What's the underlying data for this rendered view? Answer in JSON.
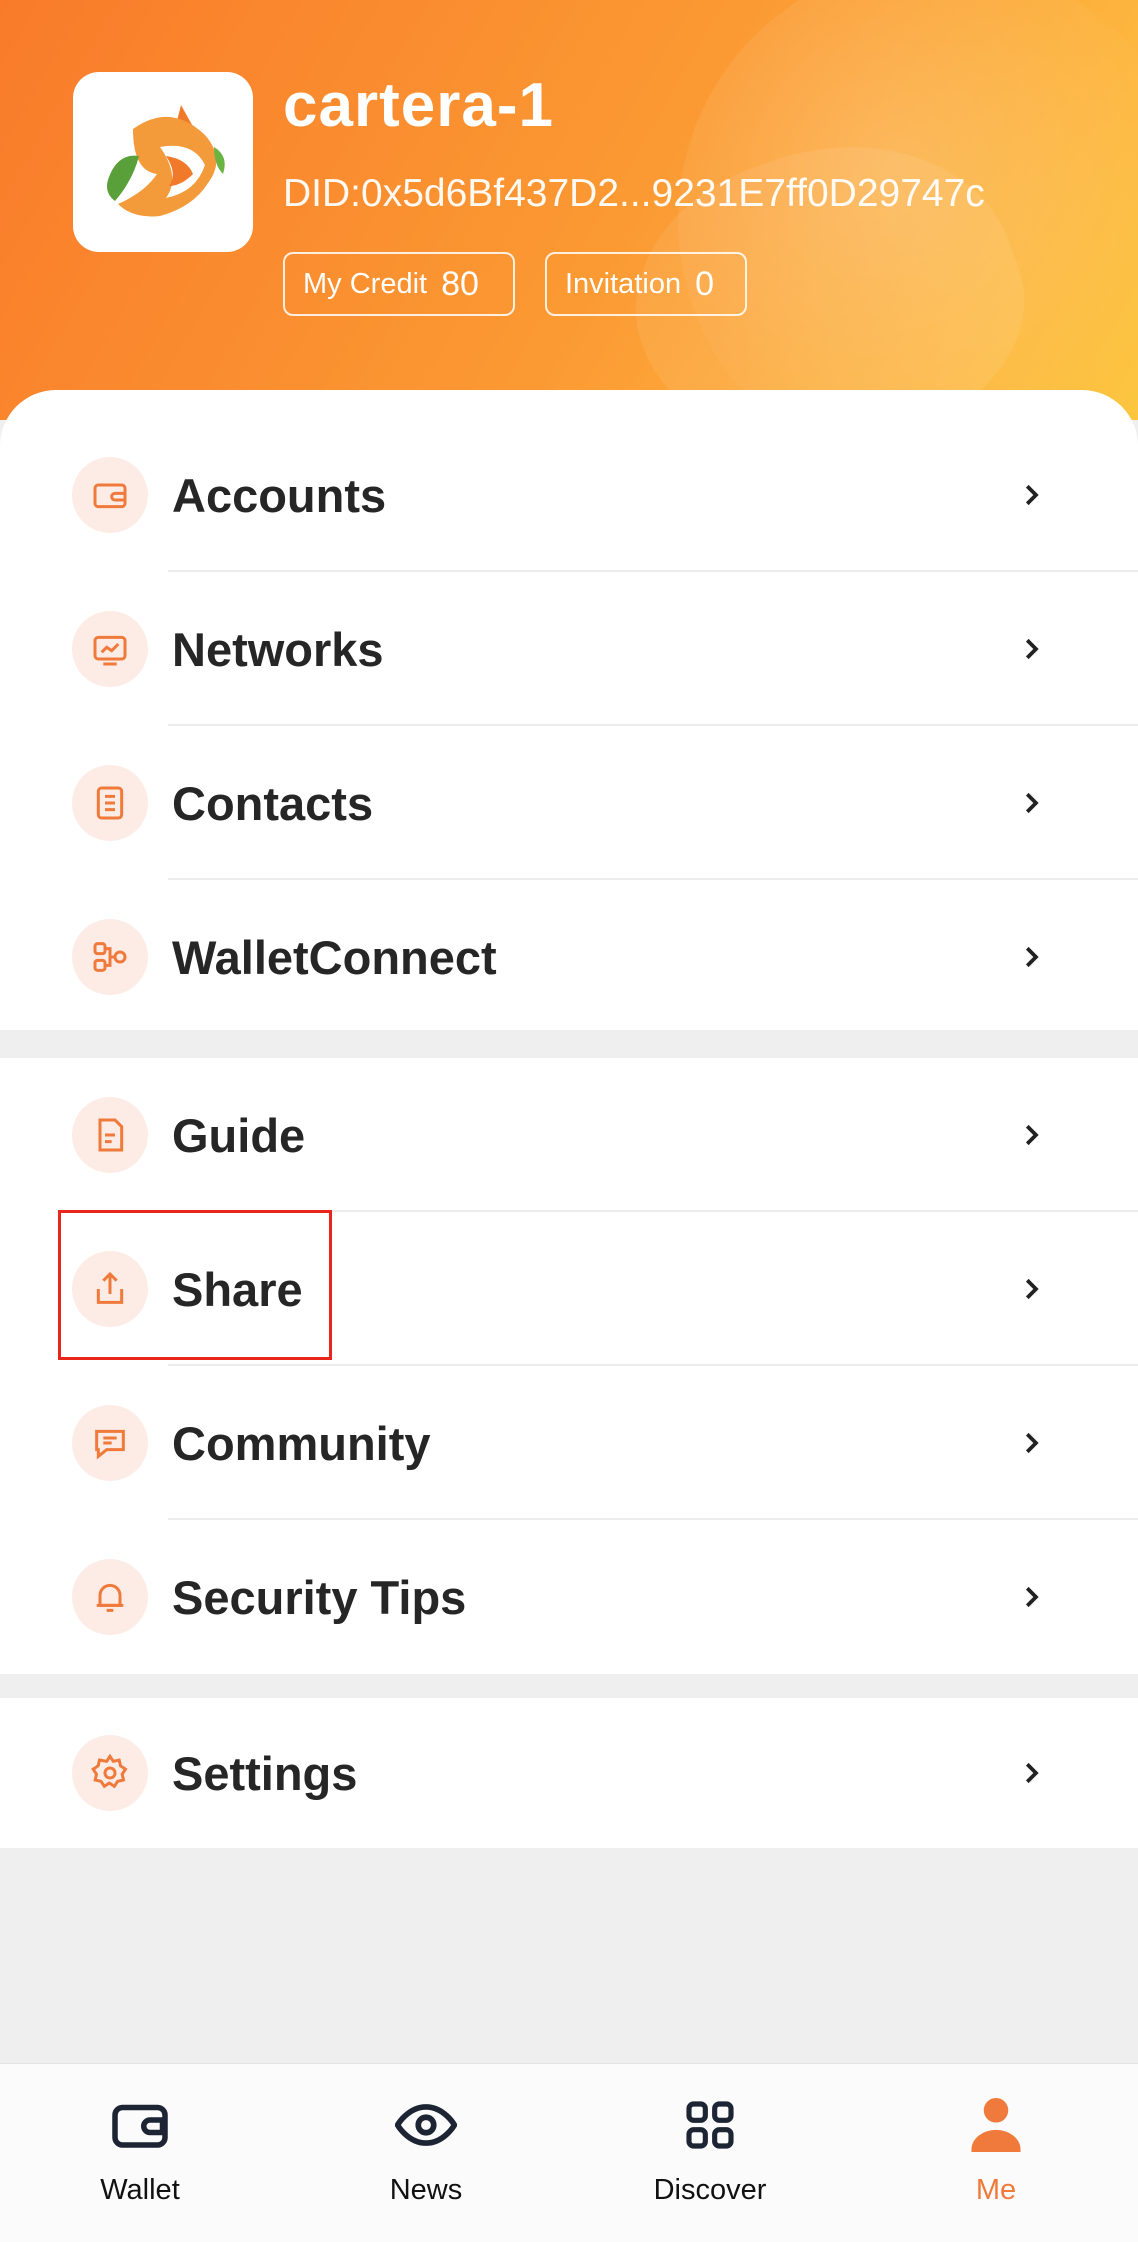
{
  "profile": {
    "name": "cartera-1",
    "did": "DID:0x5d6Bf437D2...9231E7ff0D29747c",
    "credit_label": "My Credit",
    "credit_value": "80",
    "invitation_label": "Invitation",
    "invitation_value": "0"
  },
  "menu_group1": [
    {
      "label": "Accounts",
      "icon": "wallet-icon"
    },
    {
      "label": "Networks",
      "icon": "monitor-chart-icon"
    },
    {
      "label": "Contacts",
      "icon": "clipboard-list-icon"
    },
    {
      "label": "WalletConnect",
      "icon": "link-nodes-icon"
    }
  ],
  "menu_group2": [
    {
      "label": "Guide",
      "icon": "document-icon"
    },
    {
      "label": "Share",
      "icon": "share-icon"
    },
    {
      "label": "Community",
      "icon": "chat-icon"
    },
    {
      "label": "Security Tips",
      "icon": "bell-icon"
    }
  ],
  "menu_group3": [
    {
      "label": "Settings",
      "icon": "gear-icon"
    }
  ],
  "tabbar": {
    "wallet": "Wallet",
    "news": "News",
    "discover": "Discover",
    "me": "Me"
  },
  "colors": {
    "accent": "#f07a3c",
    "header_start": "#f97b2a",
    "header_end": "#fcc640",
    "highlight": "#e8261c"
  }
}
